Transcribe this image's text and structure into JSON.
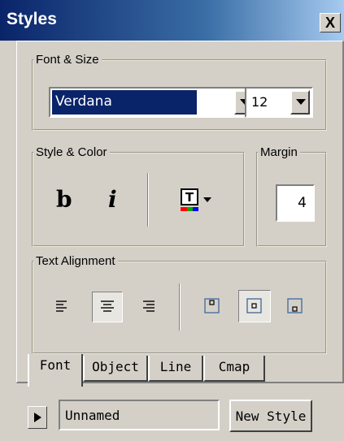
{
  "window": {
    "title": "Styles",
    "close_label": "X"
  },
  "font_size": {
    "legend": "Font & Size",
    "font_value": "Verdana",
    "size_value": "12"
  },
  "style_color": {
    "legend": "Style & Color",
    "bold_label": "b",
    "italic_label": "i",
    "text_color_icon": "text-color-icon",
    "color_bar": [
      "#ff0000",
      "#00aa00",
      "#0000ff"
    ]
  },
  "margin": {
    "legend": "Margin",
    "value": "4"
  },
  "alignment": {
    "legend": "Text Alignment",
    "selected_horizontal": "center",
    "selected_vertical": "middle"
  },
  "tabs": [
    {
      "label": "Font",
      "active": true
    },
    {
      "label": "Object",
      "active": false
    },
    {
      "label": "Line",
      "active": false
    },
    {
      "label": "Cmap",
      "active": false
    }
  ],
  "footer": {
    "style_name": "Unnamed",
    "new_style_label": "New Style"
  }
}
